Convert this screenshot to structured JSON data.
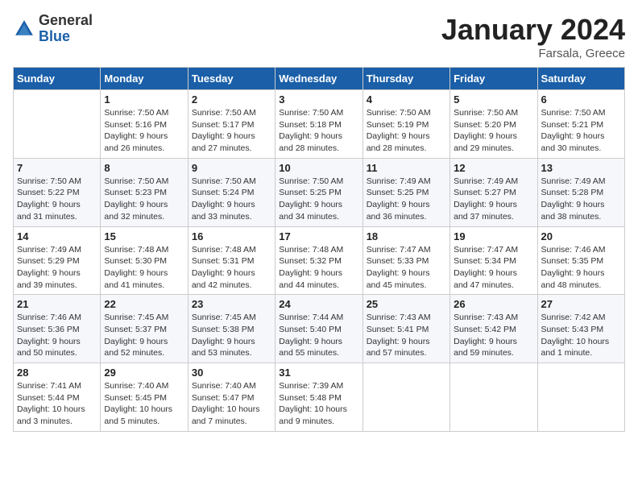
{
  "logo": {
    "general": "General",
    "blue": "Blue"
  },
  "title": "January 2024",
  "location": "Farsala, Greece",
  "days_header": [
    "Sunday",
    "Monday",
    "Tuesday",
    "Wednesday",
    "Thursday",
    "Friday",
    "Saturday"
  ],
  "weeks": [
    [
      {
        "day": "",
        "info": ""
      },
      {
        "day": "1",
        "info": "Sunrise: 7:50 AM\nSunset: 5:16 PM\nDaylight: 9 hours\nand 26 minutes."
      },
      {
        "day": "2",
        "info": "Sunrise: 7:50 AM\nSunset: 5:17 PM\nDaylight: 9 hours\nand 27 minutes."
      },
      {
        "day": "3",
        "info": "Sunrise: 7:50 AM\nSunset: 5:18 PM\nDaylight: 9 hours\nand 28 minutes."
      },
      {
        "day": "4",
        "info": "Sunrise: 7:50 AM\nSunset: 5:19 PM\nDaylight: 9 hours\nand 28 minutes."
      },
      {
        "day": "5",
        "info": "Sunrise: 7:50 AM\nSunset: 5:20 PM\nDaylight: 9 hours\nand 29 minutes."
      },
      {
        "day": "6",
        "info": "Sunrise: 7:50 AM\nSunset: 5:21 PM\nDaylight: 9 hours\nand 30 minutes."
      }
    ],
    [
      {
        "day": "7",
        "info": "Sunrise: 7:50 AM\nSunset: 5:22 PM\nDaylight: 9 hours\nand 31 minutes."
      },
      {
        "day": "8",
        "info": "Sunrise: 7:50 AM\nSunset: 5:23 PM\nDaylight: 9 hours\nand 32 minutes."
      },
      {
        "day": "9",
        "info": "Sunrise: 7:50 AM\nSunset: 5:24 PM\nDaylight: 9 hours\nand 33 minutes."
      },
      {
        "day": "10",
        "info": "Sunrise: 7:50 AM\nSunset: 5:25 PM\nDaylight: 9 hours\nand 34 minutes."
      },
      {
        "day": "11",
        "info": "Sunrise: 7:49 AM\nSunset: 5:25 PM\nDaylight: 9 hours\nand 36 minutes."
      },
      {
        "day": "12",
        "info": "Sunrise: 7:49 AM\nSunset: 5:27 PM\nDaylight: 9 hours\nand 37 minutes."
      },
      {
        "day": "13",
        "info": "Sunrise: 7:49 AM\nSunset: 5:28 PM\nDaylight: 9 hours\nand 38 minutes."
      }
    ],
    [
      {
        "day": "14",
        "info": "Sunrise: 7:49 AM\nSunset: 5:29 PM\nDaylight: 9 hours\nand 39 minutes."
      },
      {
        "day": "15",
        "info": "Sunrise: 7:48 AM\nSunset: 5:30 PM\nDaylight: 9 hours\nand 41 minutes."
      },
      {
        "day": "16",
        "info": "Sunrise: 7:48 AM\nSunset: 5:31 PM\nDaylight: 9 hours\nand 42 minutes."
      },
      {
        "day": "17",
        "info": "Sunrise: 7:48 AM\nSunset: 5:32 PM\nDaylight: 9 hours\nand 44 minutes."
      },
      {
        "day": "18",
        "info": "Sunrise: 7:47 AM\nSunset: 5:33 PM\nDaylight: 9 hours\nand 45 minutes."
      },
      {
        "day": "19",
        "info": "Sunrise: 7:47 AM\nSunset: 5:34 PM\nDaylight: 9 hours\nand 47 minutes."
      },
      {
        "day": "20",
        "info": "Sunrise: 7:46 AM\nSunset: 5:35 PM\nDaylight: 9 hours\nand 48 minutes."
      }
    ],
    [
      {
        "day": "21",
        "info": "Sunrise: 7:46 AM\nSunset: 5:36 PM\nDaylight: 9 hours\nand 50 minutes."
      },
      {
        "day": "22",
        "info": "Sunrise: 7:45 AM\nSunset: 5:37 PM\nDaylight: 9 hours\nand 52 minutes."
      },
      {
        "day": "23",
        "info": "Sunrise: 7:45 AM\nSunset: 5:38 PM\nDaylight: 9 hours\nand 53 minutes."
      },
      {
        "day": "24",
        "info": "Sunrise: 7:44 AM\nSunset: 5:40 PM\nDaylight: 9 hours\nand 55 minutes."
      },
      {
        "day": "25",
        "info": "Sunrise: 7:43 AM\nSunset: 5:41 PM\nDaylight: 9 hours\nand 57 minutes."
      },
      {
        "day": "26",
        "info": "Sunrise: 7:43 AM\nSunset: 5:42 PM\nDaylight: 9 hours\nand 59 minutes."
      },
      {
        "day": "27",
        "info": "Sunrise: 7:42 AM\nSunset: 5:43 PM\nDaylight: 10 hours\nand 1 minute."
      }
    ],
    [
      {
        "day": "28",
        "info": "Sunrise: 7:41 AM\nSunset: 5:44 PM\nDaylight: 10 hours\nand 3 minutes."
      },
      {
        "day": "29",
        "info": "Sunrise: 7:40 AM\nSunset: 5:45 PM\nDaylight: 10 hours\nand 5 minutes."
      },
      {
        "day": "30",
        "info": "Sunrise: 7:40 AM\nSunset: 5:47 PM\nDaylight: 10 hours\nand 7 minutes."
      },
      {
        "day": "31",
        "info": "Sunrise: 7:39 AM\nSunset: 5:48 PM\nDaylight: 10 hours\nand 9 minutes."
      },
      {
        "day": "",
        "info": ""
      },
      {
        "day": "",
        "info": ""
      },
      {
        "day": "",
        "info": ""
      }
    ]
  ]
}
